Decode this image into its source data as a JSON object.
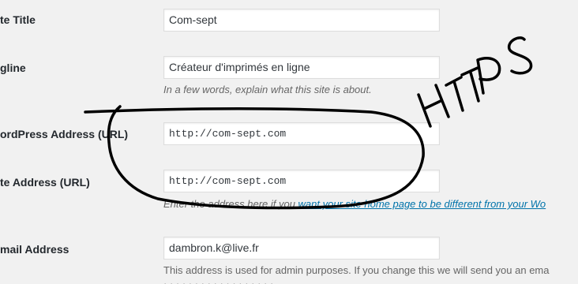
{
  "fields": {
    "site_title": {
      "label": "te Title",
      "value": "Com-sept"
    },
    "tagline": {
      "label": "gline",
      "value": "Créateur d'imprimés en ligne",
      "description": "In a few words, explain what this site is about."
    },
    "wp_address": {
      "label": "ordPress Address (URL)",
      "value": "http://com-sept.com"
    },
    "site_address": {
      "label": "te Address (URL)",
      "value": "http://com-sept.com",
      "description_prefix": "Enter the address here if you ",
      "description_link": "want your site home page to be different from your Wo"
    },
    "email": {
      "label": "mail Address",
      "value": "dambron.k@live.fr",
      "description": "This address is used for admin purposes. If you change this we will send you an ema"
    }
  },
  "annotation": {
    "handwritten_text": "HTTPS",
    "ink_color": "#000000"
  }
}
